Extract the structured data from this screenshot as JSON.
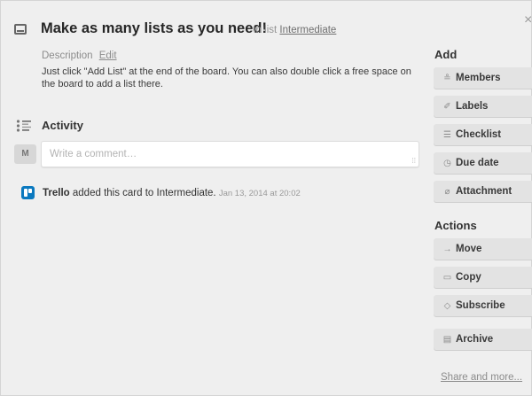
{
  "card": {
    "title": "Make as many lists as you need!",
    "in_list_prefix": "in list",
    "list_name": "Intermediate",
    "close_glyph": "×"
  },
  "description": {
    "label": "Description",
    "edit_label": "Edit",
    "text": "Just click \"Add List\" at the end of the board. You can also double click a free space on the board to add a list there."
  },
  "activity": {
    "title": "Activity",
    "avatar_initial": "M",
    "comment_placeholder": "Write a comment…",
    "entries": [
      {
        "actor": "Trello",
        "text": "added this card to Intermediate.",
        "timestamp": "Jan 13, 2014 at 20:02"
      }
    ]
  },
  "sidebar": {
    "add_heading": "Add",
    "add_buttons": [
      {
        "label": "Members",
        "icon": "person-icon",
        "glyph": "≗"
      },
      {
        "label": "Labels",
        "icon": "tag-icon",
        "glyph": "✐"
      },
      {
        "label": "Checklist",
        "icon": "checklist-icon",
        "glyph": "☰"
      },
      {
        "label": "Due date",
        "icon": "clock-icon",
        "glyph": "◷"
      },
      {
        "label": "Attachment",
        "icon": "paperclip-icon",
        "glyph": "⌀"
      }
    ],
    "actions_heading": "Actions",
    "action_buttons": [
      {
        "label": "Move",
        "icon": "arrow-right-icon",
        "glyph": "→"
      },
      {
        "label": "Copy",
        "icon": "card-icon",
        "glyph": "▭"
      },
      {
        "label": "Subscribe",
        "icon": "eye-icon",
        "glyph": "◇"
      },
      {
        "label": "Archive",
        "icon": "archive-icon",
        "glyph": "▤"
      }
    ],
    "share_label": "Share and more..."
  },
  "colors": {
    "background": "#efefef",
    "button_bg": "#e3e3e3",
    "trello_blue": "#0b79bf",
    "muted_text": "#8c8c8c"
  }
}
